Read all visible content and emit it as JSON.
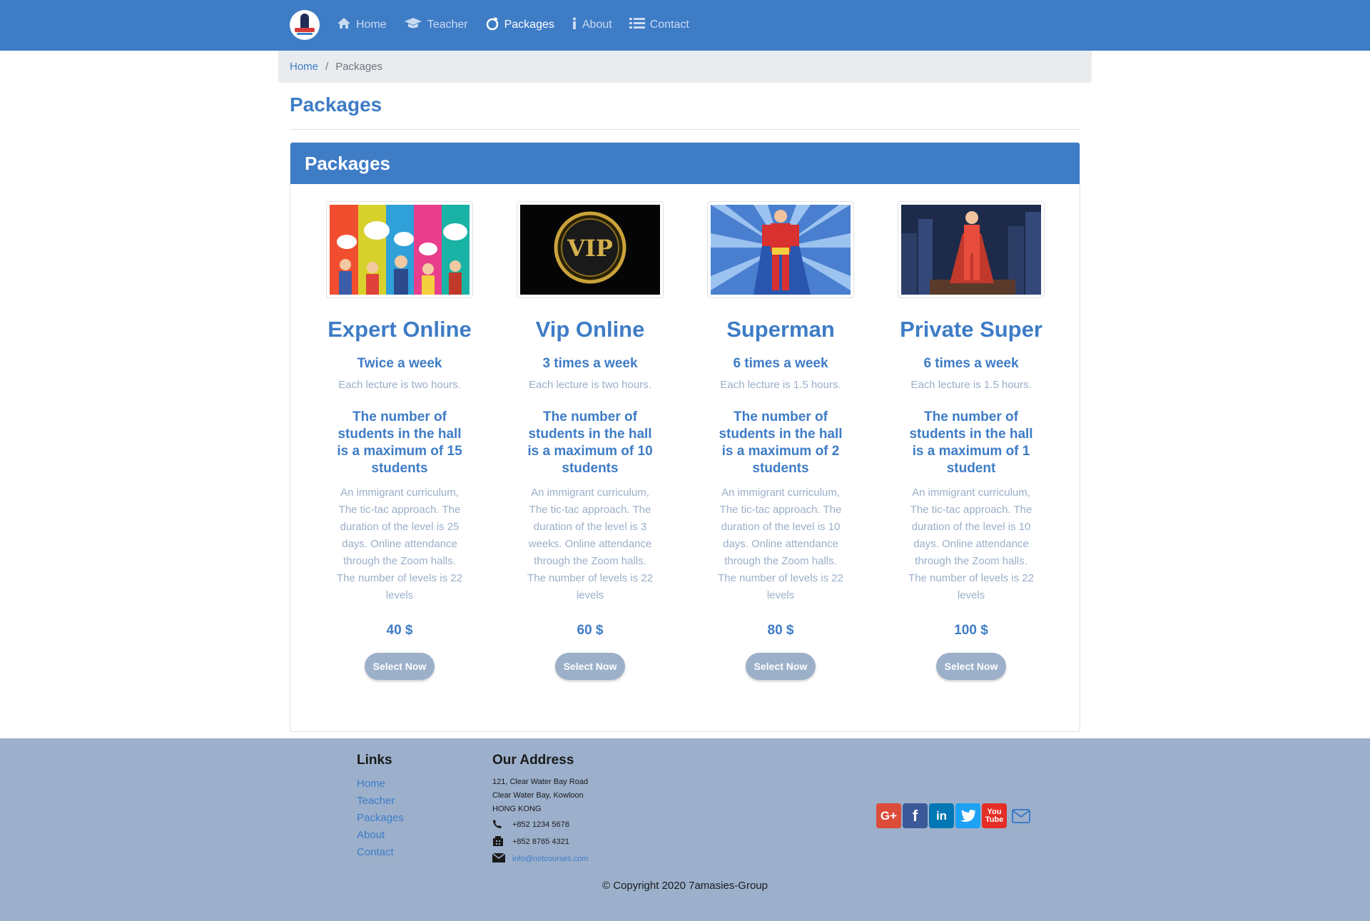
{
  "nav": {
    "items": [
      {
        "label": "Home",
        "icon": "home-icon"
      },
      {
        "label": "Teacher",
        "icon": "graduation-cap-icon"
      },
      {
        "label": "Packages",
        "icon": "refresh-icon"
      },
      {
        "label": "About",
        "icon": "info-icon"
      },
      {
        "label": "Contact",
        "icon": "list-icon"
      }
    ],
    "active": "Packages"
  },
  "breadcrumb": {
    "home": "Home",
    "separator": "/",
    "current": "Packages"
  },
  "page": {
    "title": "Packages"
  },
  "panel": {
    "title": "Packages"
  },
  "packages": [
    {
      "name": "Expert Online",
      "frequency": "Twice a week",
      "lecture": "Each lecture is two hours.",
      "students": "The number of students in the hall is a maximum of 15 students",
      "description": "An immigrant curriculum, The tic-tac approach. The duration of the level is 25 days. Online attendance through the Zoom halls. The number of levels is 22 levels",
      "price": "40 $",
      "button": "Select Now"
    },
    {
      "name": "Vip Online",
      "frequency": "3 times a week",
      "lecture": "Each lecture is two hours.",
      "students": "The number of students in the hall is a maximum of 10 students",
      "description": "An immigrant curriculum, The tic-tac approach. The duration of the level is 3 weeks. Online attendance through the Zoom halls. The number of levels is 22 levels",
      "price": "60 $",
      "button": "Select Now",
      "image_text": "VIP"
    },
    {
      "name": "Superman",
      "frequency": "6 times a week",
      "lecture": "Each lecture is 1.5 hours.",
      "students": "The number of students in the hall is a maximum of 2 students",
      "description": "An immigrant curriculum, The tic-tac approach. The duration of the level is 10 days. Online attendance through the Zoom halls. The number of levels is 22 levels",
      "price": "80 $",
      "button": "Select Now"
    },
    {
      "name": "Private Super",
      "frequency": "6 times a week",
      "lecture": "Each lecture is 1.5 hours.",
      "students": "The number of students in the hall is a maximum of 1 student",
      "description": "An immigrant curriculum, The tic-tac approach. The duration of the level is 10 days. Online attendance through the Zoom halls. The number of levels is 22 levels",
      "price": "100 $",
      "button": "Select Now"
    }
  ],
  "footer": {
    "links_heading": "Links",
    "links": [
      "Home",
      "Teacher",
      "Packages",
      "About",
      "Contact"
    ],
    "address_heading": "Our Address",
    "address_lines": [
      "121, Clear Water Bay Road",
      "Clear Water Bay, Kowloon",
      "HONG KONG"
    ],
    "phone": "+852 1234 5678",
    "fax": "+852 8765 4321",
    "email": "info@notcourses.com",
    "social": [
      {
        "icon": "google-plus-icon",
        "color": "#dd4b39"
      },
      {
        "icon": "facebook-icon",
        "color": "#3b5998"
      },
      {
        "icon": "linkedin-icon",
        "color": "#0077b5"
      },
      {
        "icon": "twitter-icon",
        "color": "#1da1f2"
      },
      {
        "icon": "youtube-icon",
        "color": "#e52d27"
      },
      {
        "icon": "mail-icon",
        "color": "#3e7cc6"
      }
    ],
    "copyright": "© Copyright 2020 7amasies-Group"
  },
  "colors": {
    "primary": "#3e7cc6",
    "muted": "#9aafc9",
    "footer_bg": "#9cb0cc",
    "button_bg": "#9cb0c9"
  }
}
